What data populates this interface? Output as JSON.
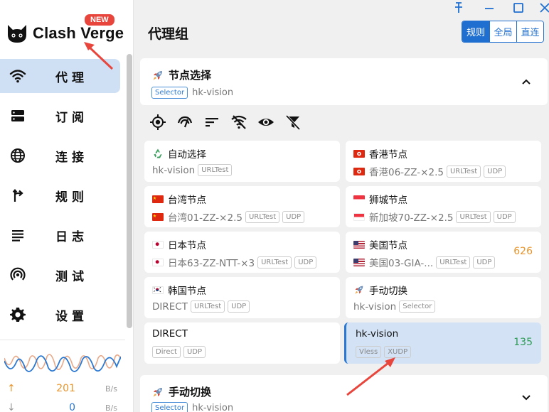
{
  "app": {
    "name": "Clash Verge",
    "new_badge": "NEW"
  },
  "sidebar": {
    "items": [
      {
        "label": "代理",
        "icon": "wifi-icon",
        "active": true
      },
      {
        "label": "订阅",
        "icon": "storage-icon"
      },
      {
        "label": "连接",
        "icon": "globe-icon"
      },
      {
        "label": "规则",
        "icon": "fork-arrow-icon"
      },
      {
        "label": "日志",
        "icon": "list-lines-icon"
      },
      {
        "label": "测试",
        "icon": "signal-icon"
      },
      {
        "label": "设置",
        "icon": "gear-icon"
      }
    ],
    "traffic": {
      "up_value": "201",
      "up_unit": "B/s",
      "down_value": "0",
      "down_unit": "B/s"
    }
  },
  "main": {
    "title": "代理组",
    "modes": [
      "规则",
      "全局",
      "直连"
    ],
    "active_mode": "规则",
    "groups": [
      {
        "name": "节点选择",
        "type": "Selector",
        "current": "hk-vision",
        "expanded": true
      },
      {
        "name": "手动切换",
        "type": "Selector",
        "current": "hk-vision",
        "expanded": false
      }
    ],
    "toolbar_icons": [
      "locate-icon",
      "speedometer-icon",
      "sort-icon",
      "signal-off-icon",
      "eye-icon",
      "filter-off-icon"
    ],
    "nodes": [
      {
        "name": "自动选择",
        "icon": "recycle",
        "sub": "hk-vision",
        "tags": [
          "URLTest"
        ],
        "delay": ""
      },
      {
        "name": "香港节点",
        "flag": "hk",
        "sub": "香港06-ZZ-×2.5",
        "sub_flag": "hk",
        "tags": [
          "URLTest",
          "UDP"
        ],
        "delay": ""
      },
      {
        "name": "台湾节点",
        "flag": "cn",
        "sub": "台湾01-ZZ-×2.5",
        "sub_flag": "cn",
        "tags": [
          "URLTest",
          "UDP"
        ],
        "delay": ""
      },
      {
        "name": "狮城节点",
        "flag": "sg",
        "sub": "新加坡70-ZZ-×2.5",
        "sub_flag": "sg",
        "tags": [
          "URLTest",
          "UDP"
        ],
        "delay": ""
      },
      {
        "name": "日本节点",
        "flag": "jp",
        "sub": "日本63-ZZ-NTT-×3",
        "sub_flag": "jp",
        "tags": [
          "URLTest",
          "UDP"
        ],
        "delay": ""
      },
      {
        "name": "美国节点",
        "flag": "us",
        "sub": "美国03-GIA-...",
        "sub_flag": "us",
        "tags": [
          "URLTest",
          "UDP"
        ],
        "delay": "626"
      },
      {
        "name": "韩国节点",
        "flag": "kr",
        "sub": "DIRECT",
        "tags": [
          "URLTest",
          "UDP"
        ],
        "delay": ""
      },
      {
        "name": "手动切换",
        "icon": "rocket",
        "sub": "hk-vision",
        "tags": [
          "Selector"
        ],
        "delay": ""
      },
      {
        "name": "DIRECT",
        "sub": "",
        "tags": [
          "Direct",
          "UDP"
        ],
        "delay": ""
      },
      {
        "name": "hk-vision",
        "sub": "",
        "tags": [
          "Vless",
          "XUDP"
        ],
        "delay": "135",
        "selected": true
      }
    ]
  },
  "colors": {
    "accent": "#1f6fd1",
    "selected_bg": "#d3e3f5",
    "delay_orange": "#e8942b",
    "delay_green": "#2e9a56",
    "arrow_red": "#e8453c"
  }
}
